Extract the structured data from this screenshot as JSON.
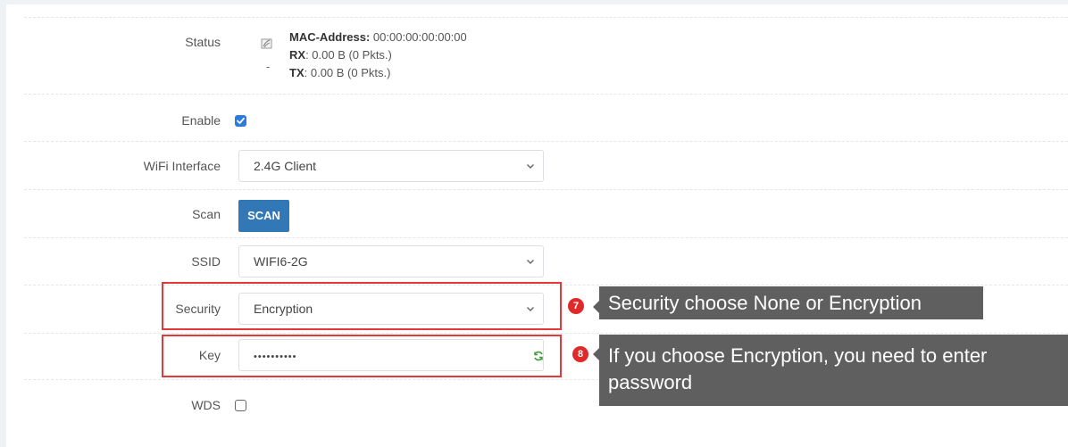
{
  "form": {
    "status": {
      "label": "Status",
      "mac_label": "MAC-Address:",
      "mac_value": "00:00:00:00:00:00",
      "rx_label": "RX",
      "rx_value": ": 0.00 B (0 Pkts.)",
      "tx_label": "TX",
      "tx_value": ": 0.00 B (0 Pkts.)",
      "dash": "-"
    },
    "enable": {
      "label": "Enable",
      "checked": true
    },
    "wifi_interface": {
      "label": "WiFi Interface",
      "value": "2.4G Client"
    },
    "scan": {
      "label": "Scan",
      "button": "SCAN"
    },
    "ssid": {
      "label": "SSID",
      "value": "WIFI6-2G"
    },
    "security": {
      "label": "Security",
      "value": "Encryption"
    },
    "key": {
      "label": "Key",
      "value": "••••••••••"
    },
    "wds": {
      "label": "WDS",
      "checked": false
    }
  },
  "annotations": {
    "step7": {
      "number": "7",
      "text": "Security choose None or Encryption"
    },
    "step8": {
      "number": "8",
      "text": "If you choose Encryption, you need to enter password"
    }
  },
  "colors": {
    "accent": "#3278b7",
    "highlight_box": "#e23a3a",
    "badge": "#e02a2a",
    "callout_bg": "#5f5f5f"
  },
  "icons": {
    "status": "wireless-status-icon",
    "reveal": "reveal-password-icon",
    "dropdown": "chevron-down-icon"
  }
}
